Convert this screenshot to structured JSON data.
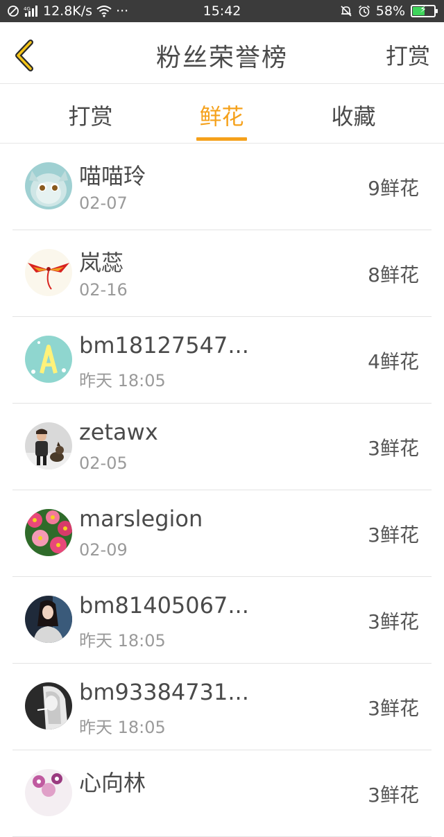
{
  "status_bar": {
    "network_speed": "12.8K/s",
    "more": "···",
    "time": "15:42",
    "battery": "58%",
    "battery_level": 0.58
  },
  "header": {
    "title": "粉丝荣誉榜",
    "action": "打赏"
  },
  "tabs": [
    {
      "label": "打赏",
      "active": false
    },
    {
      "label": "鲜花",
      "active": true
    },
    {
      "label": "收藏",
      "active": false
    }
  ],
  "list": [
    {
      "name": "喵喵玲",
      "date": "02-07",
      "count": "9鲜花",
      "avatar": "cartoon-cat-avatar"
    },
    {
      "name": "岚蕊",
      "date": "02-16",
      "count": "8鲜花",
      "avatar": "phoenix-avatar"
    },
    {
      "name": "bm18127547...",
      "date": "昨天 18:05",
      "count": "4鲜花",
      "avatar": "letter-a-avatar"
    },
    {
      "name": "zetawx",
      "date": "02-05",
      "count": "3鲜花",
      "avatar": "child-with-dog-avatar"
    },
    {
      "name": "marslegion",
      "date": "02-09",
      "count": "3鲜花",
      "avatar": "flowers-avatar"
    },
    {
      "name": "bm81405067...",
      "date": "昨天 18:05",
      "count": "3鲜花",
      "avatar": "girl-photo-avatar"
    },
    {
      "name": "bm93384731...",
      "date": "昨天 18:05",
      "count": "3鲜花",
      "avatar": "monochrome-portrait-avatar"
    },
    {
      "name": "心向林",
      "date": "",
      "count": "3鲜花",
      "avatar": "floral-avatar"
    }
  ],
  "colors": {
    "accent": "#f5a11b",
    "status_bar_bg": "#3b3b3b",
    "text_primary": "#4a4a4a",
    "text_secondary": "#9a9a9a"
  }
}
